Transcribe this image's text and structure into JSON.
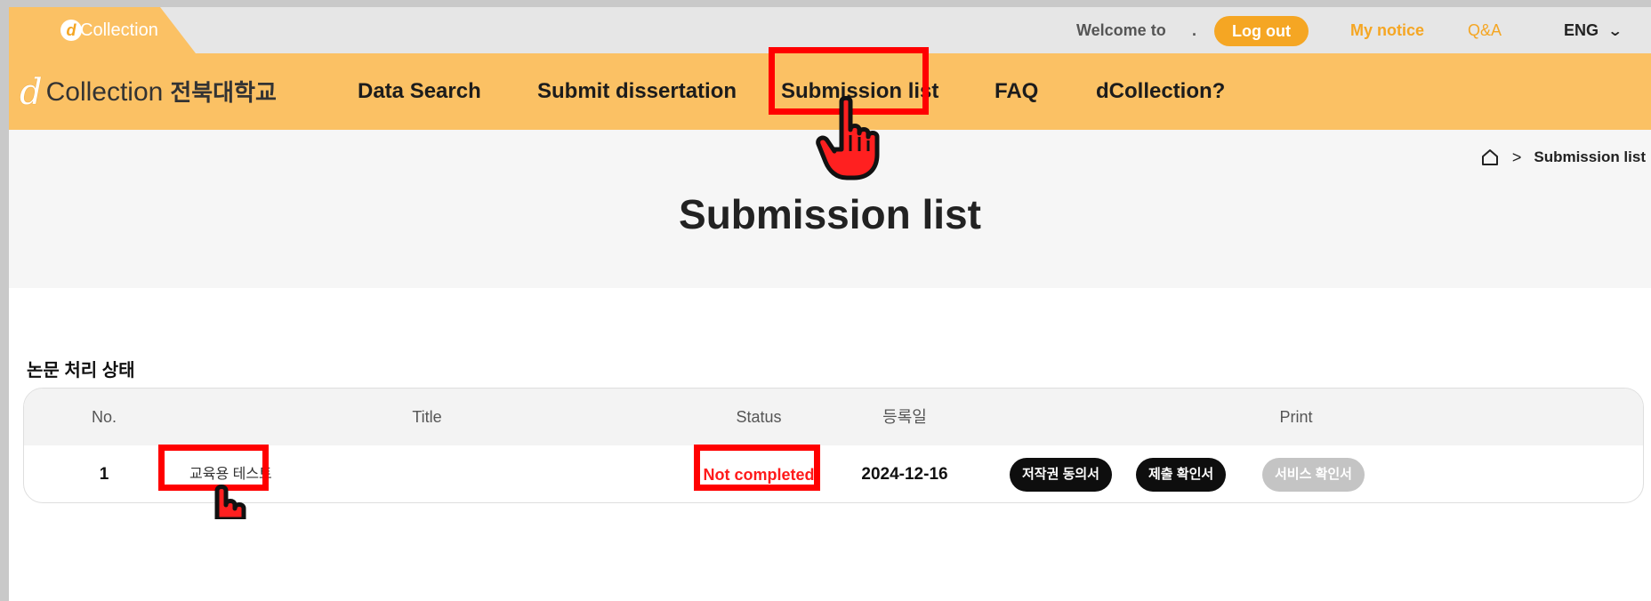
{
  "topbar": {
    "brand_letter": "d",
    "brand_label": "Collection",
    "welcome": "Welcome to",
    "welcome_dot": ".",
    "logout": "Log out",
    "my_notice": "My notice",
    "qa": "Q&A",
    "language": "ENG",
    "language_caret": "⌄"
  },
  "nav": {
    "logo_letter": "d",
    "logo_text": "Collection",
    "logo_university": "전북대학교",
    "items": [
      {
        "label": "Data Search"
      },
      {
        "label": "Submit dissertation"
      },
      {
        "label": "Submission list"
      },
      {
        "label": "FAQ"
      },
      {
        "label": "dCollection?"
      }
    ]
  },
  "breadcrumb": {
    "separator": ">",
    "current": "Submission list"
  },
  "page": {
    "title": "Submission list",
    "section_title": "논문 처리 상태"
  },
  "table": {
    "headers": {
      "no": "No.",
      "title": "Title",
      "status": "Status",
      "date": "등록일",
      "print": "Print"
    },
    "rows": [
      {
        "no": "1",
        "title": "교육용 테스트",
        "status": "Not completed",
        "date": "2024-12-16",
        "print_buttons": [
          "저작권 동의서",
          "제출 확인서",
          "서비스 확인서"
        ]
      }
    ]
  },
  "colors": {
    "accent": "#f5a623",
    "nav_bg": "#fbc164",
    "highlight": "#ff0000",
    "status_red": "#ff1a1a"
  }
}
